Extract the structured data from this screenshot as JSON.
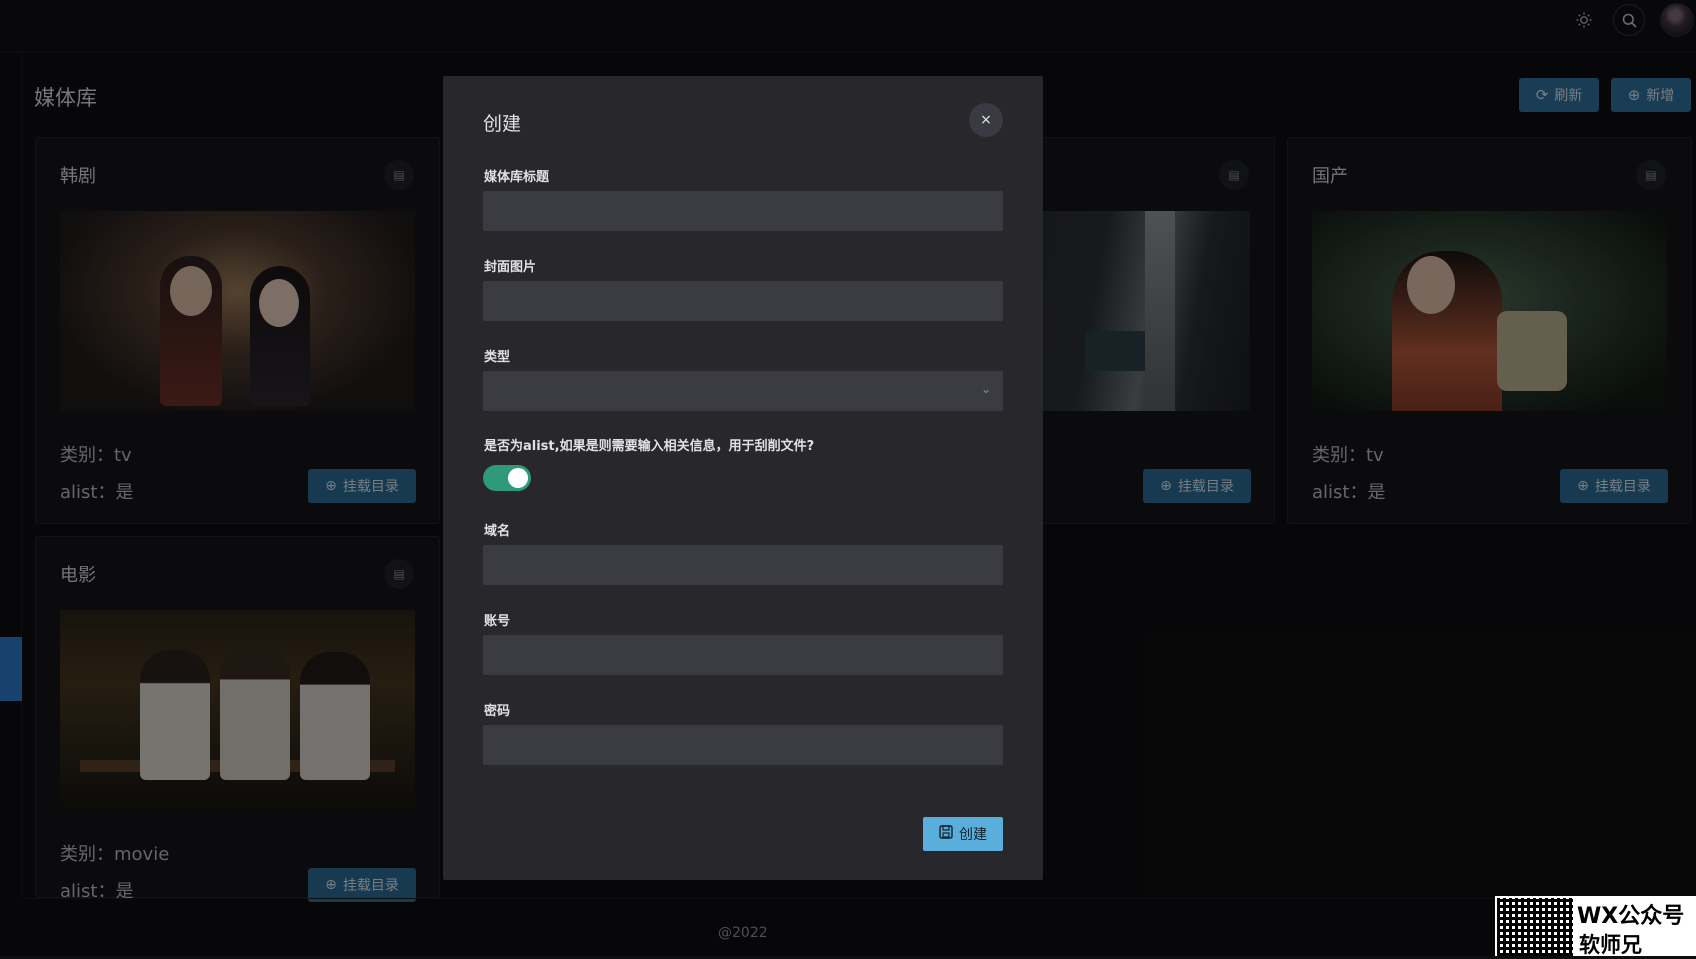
{
  "header": {
    "theme_icon": "sun-icon",
    "search_icon": "search-icon"
  },
  "page": {
    "title": "媒体库",
    "refresh_label": "刷新",
    "add_label": "新增"
  },
  "cards": [
    {
      "title": "韩剧",
      "category": "类别：tv",
      "alist": "alist：是",
      "mount_label": "挂载目录"
    },
    {
      "title": "",
      "category": "",
      "alist": "",
      "mount_label": "挂载目录"
    },
    {
      "title": "国产",
      "category": "类别：tv",
      "alist": "alist：是",
      "mount_label": "挂载目录"
    },
    {
      "title": "电影",
      "category": "类别：movie",
      "alist": "alist：是",
      "mount_label": "挂载目录"
    }
  ],
  "dialog": {
    "title": "创建",
    "close_glyph": "×",
    "fields": {
      "title_label": "媒体库标题",
      "title_value": "",
      "cover_label": "封面图片",
      "cover_value": "",
      "type_label": "类型",
      "type_value": "",
      "alist_label": "是否为alist,如果是则需要输入相关信息，用于刮削文件?",
      "alist_enabled": true,
      "domain_label": "域名",
      "domain_value": "",
      "account_label": "账号",
      "account_value": "",
      "password_label": "密码",
      "password_value": ""
    },
    "create_label": "创建"
  },
  "footer": {
    "text": "@2022"
  },
  "watermark": {
    "line1": "WX公众号",
    "line2": "软师兄"
  },
  "colors": {
    "accent": "#2e6f99",
    "toggle_on": "#2f9a77",
    "primary_button": "#5aaedb"
  }
}
